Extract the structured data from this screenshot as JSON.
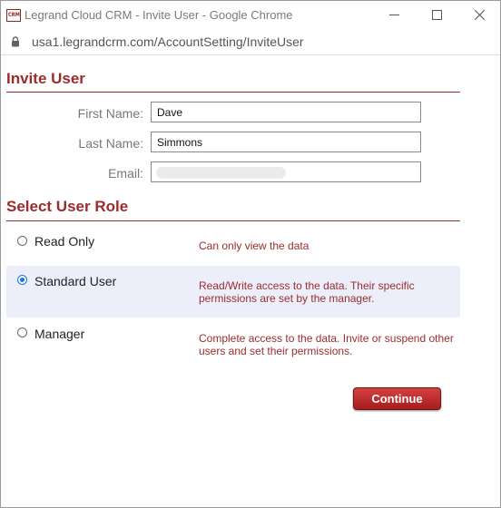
{
  "window": {
    "title": "Legrand Cloud CRM - Invite User - Google Chrome",
    "logo_text": "CRM",
    "url": "usa1.legrandcrm.com/AccountSetting/InviteUser"
  },
  "invite": {
    "heading": "Invite User",
    "first_name_label": "First Name:",
    "first_name_value": "Dave",
    "last_name_label": "Last Name:",
    "last_name_value": "Simmons",
    "email_label": "Email:",
    "email_value": ""
  },
  "role": {
    "heading": "Select User Role",
    "selected": "Standard User",
    "options": [
      {
        "name": "Read Only",
        "description": "Can only view the data"
      },
      {
        "name": "Standard User",
        "description": "Read/Write access to the data. Their specific permissions are set by the manager."
      },
      {
        "name": "Manager",
        "description": "Complete access to the data. Invite or suspend other users and set their permissions."
      }
    ]
  },
  "actions": {
    "continue_label": "Continue"
  },
  "colors": {
    "accent": "#9b2c2c",
    "selected_row": "#eceef9",
    "button": "#b52626"
  }
}
